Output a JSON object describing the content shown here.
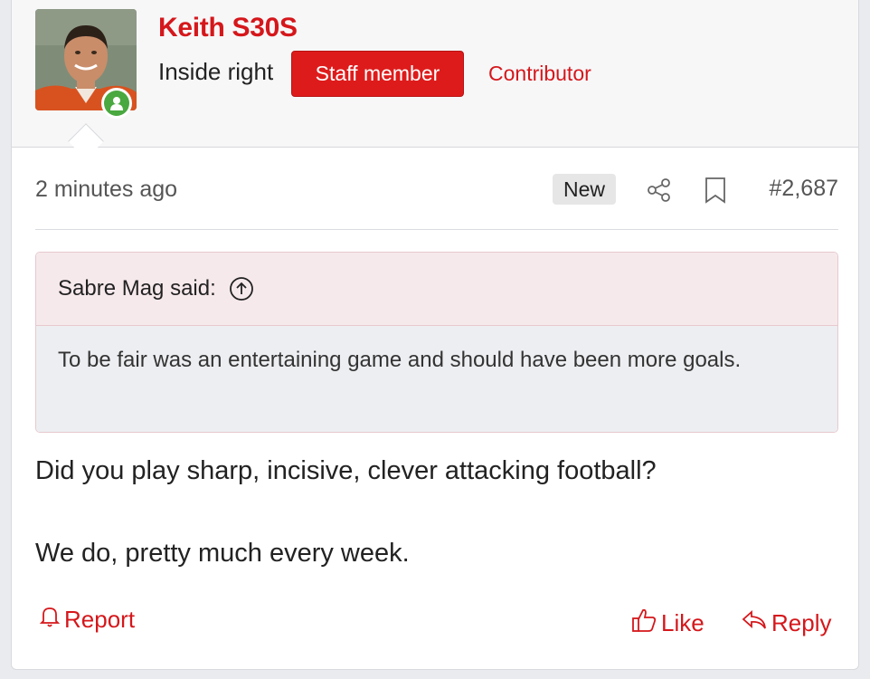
{
  "user": {
    "name": "Keith S30S",
    "title": "Inside right",
    "staff_badge": "Staff member",
    "banner": "Contributor"
  },
  "post": {
    "time": "2 minutes ago",
    "new_label": "New",
    "number": "#2,687",
    "quote": {
      "author": "Sabre Mag said:",
      "text": "To be fair was an entertaining game and should have been more goals."
    },
    "lines": [
      "Did you play sharp, incisive, clever attacking football?",
      "We do, pretty much every week."
    ]
  },
  "actions": {
    "report": "Report",
    "like": "Like",
    "reply": "Reply"
  },
  "colors": {
    "accent": "#d5171b",
    "staff_badge": "#de1b1b",
    "online": "#49a83f",
    "quote_head": "#f6e9ec",
    "quote_body": "#edeef1"
  },
  "icons": [
    "user-online-icon",
    "share-icon",
    "bookmark-icon",
    "quote-jump-arrow-icon",
    "bell-icon",
    "thumbs-up-icon",
    "reply-arrow-icon"
  ]
}
